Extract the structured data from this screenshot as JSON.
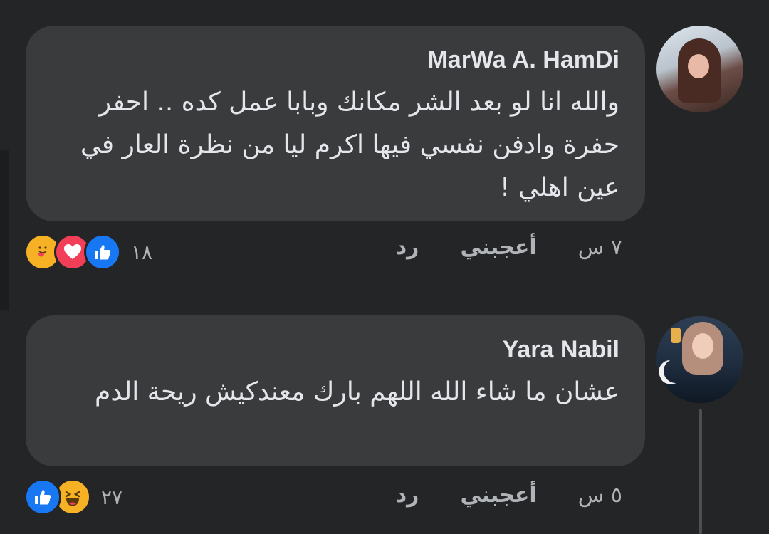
{
  "comments": [
    {
      "author": "MarWa A. HamDi",
      "text": "والله انا لو بعد الشر مكانك وبابا عمل كده .. احفر حفرة وادفن نفسي فيها اكرم ليا من نظرة العار في عين اهلي !",
      "time": "٧ س",
      "like_label": "أعجبني",
      "reply_label": "رد",
      "reaction_count": "١٨",
      "reactions": [
        "care-icon",
        "love-icon",
        "like-icon"
      ]
    },
    {
      "author": "Yara Nabil",
      "text": "عشان ما شاء الله اللهم بارك معندكيش ريحة الدم",
      "time": "٥ س",
      "like_label": "أعجبني",
      "reply_label": "رد",
      "reaction_count": "٢٧",
      "reactions": [
        "like-icon",
        "haha-icon"
      ]
    }
  ],
  "colors": {
    "background": "#242526",
    "bubble": "#3a3b3c",
    "text": "#e4e6eb",
    "meta": "#b0b3b8",
    "like_blue": "#1877f2",
    "love_red": "#f33e58",
    "care_yellow": "#f7b125"
  }
}
